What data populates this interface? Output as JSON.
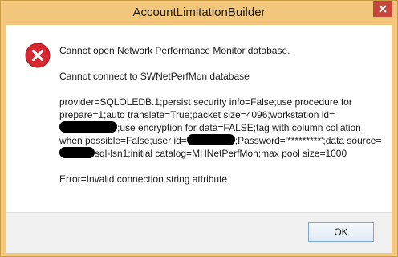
{
  "window": {
    "title": "AccountLimitationBuilder"
  },
  "message": {
    "line1": "Cannot open Network Performance Monitor database.",
    "line2": "Cannot connect to SWNetPerfMon database",
    "conn_part1": "provider=SQLOLEDB.1;persist security info=False;use procedure for prepare=1;auto translate=True;packet size=4096;workstation id=",
    "conn_part2": ";use encryption for data=FALSE;tag with column collation when possible=False;user id=",
    "conn_part3": ";Password='*********';data source=",
    "conn_part4": "sql-lsn1;initial catalog=MHNetPerfMon;max pool size=1000",
    "error": "Error=Invalid connection string attribute"
  },
  "buttons": {
    "ok_label": "OK"
  },
  "icons": {
    "error": "error-icon",
    "close": "close-icon"
  },
  "colors": {
    "title_bar": "#f2c77c",
    "close_button": "#c7463c",
    "error_icon": "#d7282f"
  }
}
